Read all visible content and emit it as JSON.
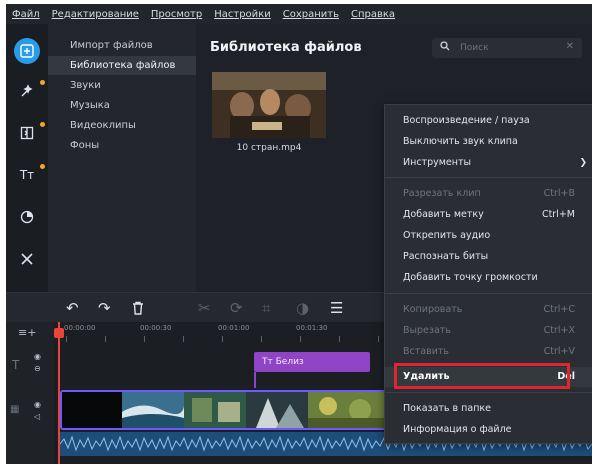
{
  "menubar": [
    "Файл",
    "Редактирование",
    "Просмотр",
    "Настройки",
    "Сохранить",
    "Справка"
  ],
  "categories": [
    "Импорт файлов",
    "Библиотека файлов",
    "Звуки",
    "Музыка",
    "Видеоклипы",
    "Фоны"
  ],
  "library": {
    "title": "Библиотека файлов",
    "search_placeholder": "Поиск",
    "file_name": "10 стран.mp4"
  },
  "timeline": {
    "ruler": [
      "00:00:00",
      "00:00:30",
      "00:01:00",
      "00:01:30"
    ],
    "text_clip_label": "Tт Белиз"
  },
  "context_menu": [
    {
      "label": "Воспроизведение / пауза",
      "shortcut": "",
      "enabled": true
    },
    {
      "label": "Выключить звук клипа",
      "shortcut": "",
      "enabled": true
    },
    {
      "label": "Инструменты",
      "shortcut": "",
      "enabled": true,
      "submenu": true
    },
    {
      "label": "Разрезать клип",
      "shortcut": "Ctrl+B",
      "enabled": false
    },
    {
      "label": "Добавить метку",
      "shortcut": "Ctrl+M",
      "enabled": true
    },
    {
      "label": "Открепить аудио",
      "shortcut": "",
      "enabled": true
    },
    {
      "label": "Распознать биты",
      "shortcut": "",
      "enabled": true
    },
    {
      "label": "Добавить точку громкости",
      "shortcut": "",
      "enabled": true
    },
    {
      "label": "Копировать",
      "shortcut": "Ctrl+C",
      "enabled": false
    },
    {
      "label": "Вырезать",
      "shortcut": "Ctrl+X",
      "enabled": false
    },
    {
      "label": "Вставить",
      "shortcut": "Ctrl+V",
      "enabled": false
    },
    {
      "label": "Удалить",
      "shortcut": "Del",
      "enabled": true,
      "highlighted": true
    },
    {
      "label": "Показать в папке",
      "shortcut": "",
      "enabled": true
    },
    {
      "label": "Информация о файле",
      "shortcut": "",
      "enabled": true
    }
  ],
  "icons": {
    "rail": [
      "import-icon",
      "effects-icon",
      "transitions-icon",
      "titles-icon",
      "stickers-icon",
      "tools-icon"
    ],
    "toolbar": [
      "undo-icon",
      "redo-icon",
      "trash-icon",
      "scissors-icon",
      "rotate-icon",
      "crop-icon",
      "color-icon",
      "adjust-icon"
    ]
  },
  "colors": {
    "accent": "#2a9be8",
    "playhead": "#e8453c",
    "text_clip": "#8e44c5",
    "highlight_box": "#e0262d",
    "clip_border": "#6e58ff",
    "audio_track": "#1d4d7a"
  }
}
